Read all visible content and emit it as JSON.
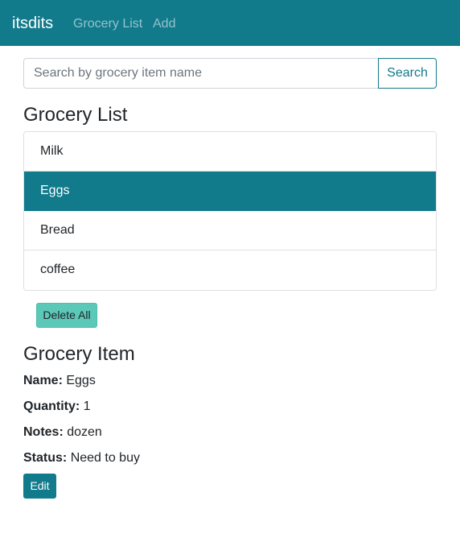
{
  "navbar": {
    "brand": "itsdits",
    "links": [
      "Grocery List",
      "Add"
    ]
  },
  "search": {
    "placeholder": "Search by grocery item name",
    "value": "",
    "button_label": "Search"
  },
  "grocery_list": {
    "title": "Grocery List",
    "items": [
      "Milk",
      "Eggs",
      "Bread",
      "coffee"
    ],
    "selected_index": 1,
    "delete_all_label": "Delete All"
  },
  "grocery_item": {
    "title": "Grocery Item",
    "name_label": "Name:",
    "name": "Eggs",
    "quantity_label": "Quantity:",
    "quantity": "1",
    "notes_label": "Notes:",
    "notes": "dozen",
    "status_label": "Status:",
    "status": "Need to buy",
    "edit_label": "Edit"
  },
  "colors": {
    "primary": "#117a8b",
    "delete_button": "#5bc8b8"
  }
}
